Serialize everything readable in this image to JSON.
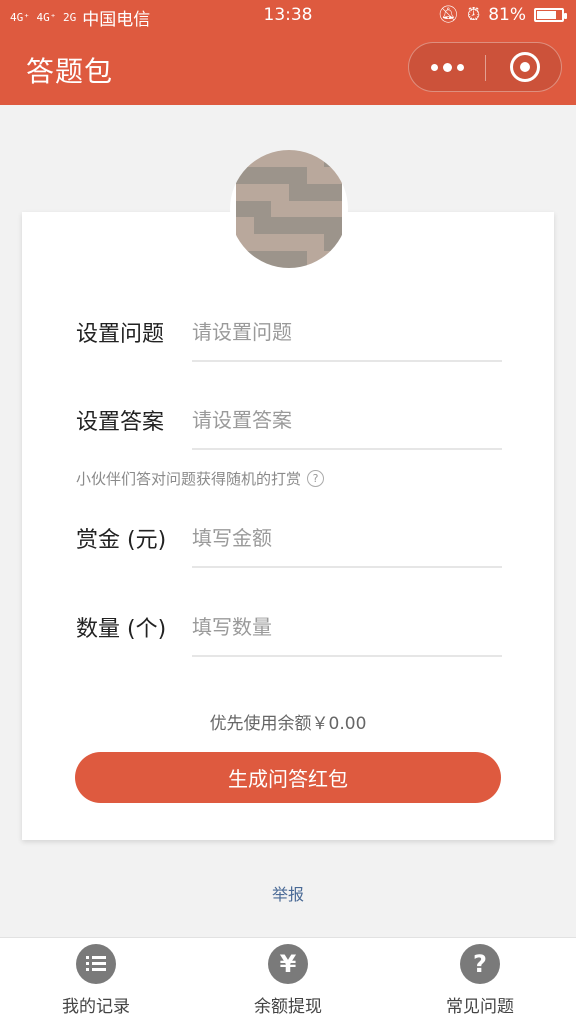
{
  "status_bar": {
    "network": "4G⁺ 4G⁺ 2G",
    "carrier": "中国电信",
    "time": "13:38",
    "battery": "81%",
    "battery_level": 0.81
  },
  "header": {
    "title": "答题包",
    "background_color": "#de5a3f"
  },
  "form": {
    "question": {
      "label": "设置问题",
      "placeholder": "请设置问题"
    },
    "answer": {
      "label": "设置答案",
      "placeholder": "请设置答案"
    },
    "hint": "小伙伴们答对问题获得随机的打赏",
    "hint_icon": "?",
    "reward": {
      "label": "赏金 (元)",
      "placeholder": "填写金额"
    },
    "quantity": {
      "label": "数量 (个)",
      "placeholder": "填写数量"
    },
    "balance_text": "优先使用余额￥0.00",
    "submit_label": "生成问答红包"
  },
  "report_link": "举报",
  "tabbar": {
    "items": [
      {
        "label": "我的记录",
        "icon": "list-icon"
      },
      {
        "label": "余额提现",
        "icon": "yen-icon",
        "glyph": "¥"
      },
      {
        "label": "常见问题",
        "icon": "question-icon",
        "glyph": "?"
      }
    ]
  }
}
